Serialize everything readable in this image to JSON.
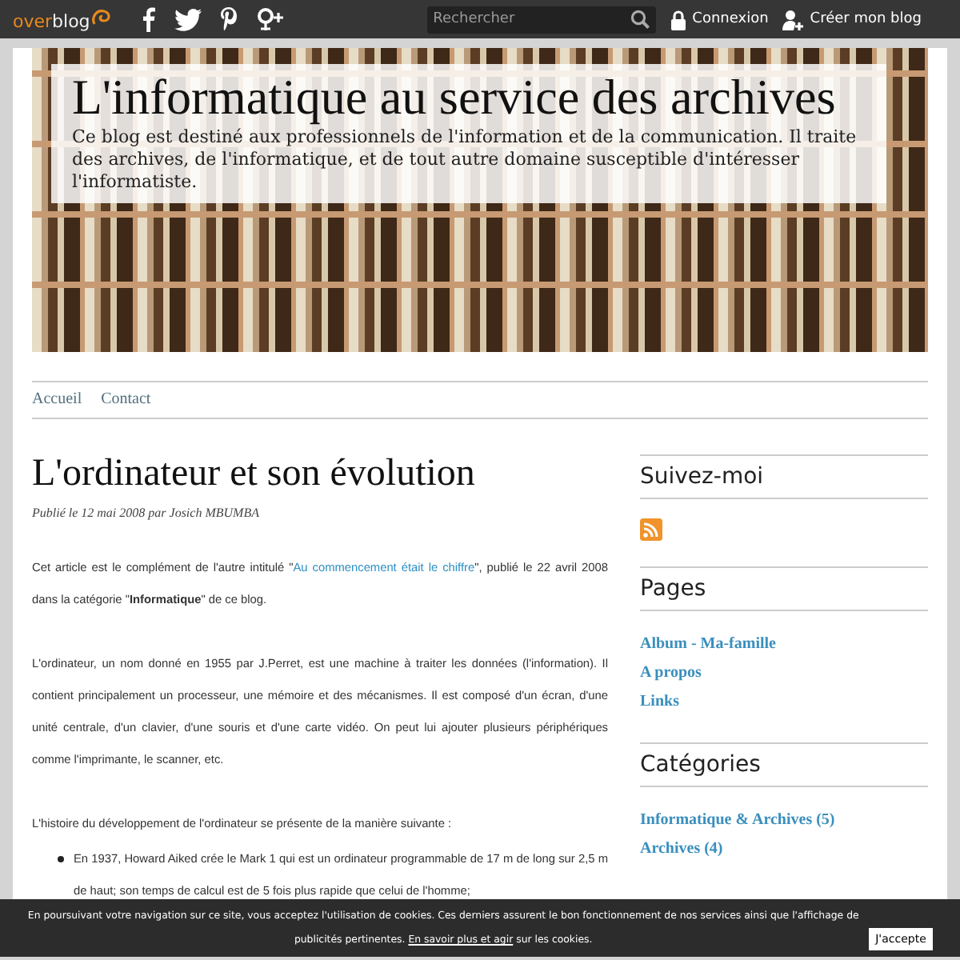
{
  "topbar": {
    "logo": {
      "first": "over",
      "second": "blog"
    },
    "search": {
      "placeholder": "Rechercher"
    },
    "login": "Connexion",
    "create": "Créer mon blog"
  },
  "header": {
    "title": "L'informatique au service des archives",
    "description": "Ce blog est destiné aux professionnels de l'information et de la communication. Il traite des archives, de l'informatique, et de tout autre domaine susceptible d'intéresser l'informatiste."
  },
  "nav": [
    "Accueil",
    "Contact"
  ],
  "article": {
    "title": "L'ordinateur et son évolution",
    "byline": "Publié le 12 mai 2008 par Josich MBUMBA",
    "intro": {
      "before": "Cet article est le complément de l'autre intitulé  \"",
      "link": "Au commencement était le chiffre",
      "after": "\", publié le 22 avril 2008 dans la catégorie \"**Informatique**\" de ce blog."
    },
    "paragraphs": [
      "L'ordinateur, un nom donné en 1955 par J.Perret, est une machine à traiter les données (l'information). Il contient principalement un processeur, une mémoire et des mécanismes. Il est composé d'un écran, d'une unité centrale, d'un clavier, d'une souris et d'une carte vidéo. On peut lui ajouter plusieurs périphériques comme l'imprimante, le scanner, etc.",
      "L'histoire du développement de l'ordinateur se présente de la manière suivante :"
    ],
    "list": [
      "En 1937, Howard Aiked crée le Mark 1 qui est un ordinateur programmable de 17 m de long sur 2,5 m de haut; son temps de calcul est de 5 fois plus rapide que celui de l'homme;"
    ]
  },
  "sidebar": [
    {
      "kind": "follow",
      "title": "Suivez-moi"
    },
    {
      "kind": "links",
      "title": "Pages",
      "items": [
        "Album - Ma-famille",
        "A propos",
        "Links"
      ]
    },
    {
      "kind": "links",
      "title": "Catégories",
      "items": [
        "Informatique & Archives (5)",
        "Archives (4)"
      ]
    }
  ],
  "cookie": {
    "text": "En poursuivant votre navigation sur ce site, vous acceptez l'utilisation de cookies. Ces derniers assurent le bon fonctionnement de nos services ainsi que l'affichage de publicités pertinentes.",
    "link": "En savoir plus et agir",
    "after": "sur les cookies.",
    "button": "J'accepte"
  }
}
